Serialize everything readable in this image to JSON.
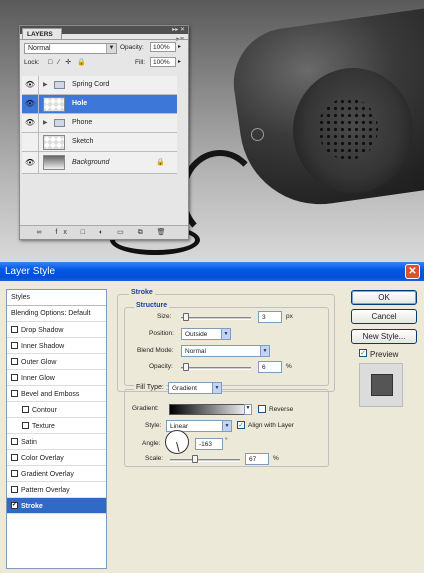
{
  "layers_panel": {
    "tab": "LAYERS",
    "menu_glyph": "▸≡",
    "collapse_glyph": "▸▸ ✕",
    "blend_mode": "Normal",
    "opacity_label": "Opacity:",
    "opacity_value": "100%",
    "lock_label": "Lock:",
    "lock_icons": "□ ∕ ✛ 🔒",
    "fill_label": "Fill:",
    "fill_value": "100%",
    "eye_glyph": "👁",
    "expand_glyph": "▶",
    "lock_glyph": "🔒",
    "layers": [
      {
        "name": "Spring Cord"
      },
      {
        "name": "Hole"
      },
      {
        "name": "Phone"
      },
      {
        "name": "Sketch"
      },
      {
        "name": "Background"
      }
    ],
    "footer_icons": "∞ fx □ ◐ ▭ ⧉ 🗑"
  },
  "dialog": {
    "title": "Layer Style",
    "close": "✕",
    "styles_header": "Styles",
    "blending_options": "Blending Options: Default",
    "style_items": [
      "Drop Shadow",
      "Inner Shadow",
      "Outer Glow",
      "Inner Glow",
      "Bevel and Emboss",
      "Contour",
      "Texture",
      "Satin",
      "Color Overlay",
      "Gradient Overlay",
      "Pattern Overlay",
      "Stroke"
    ],
    "stroke_group": "Stroke",
    "structure_group": "Structure",
    "size_label": "Size:",
    "size_value": "3",
    "size_unit": "px",
    "position_label": "Position:",
    "position_value": "Outside",
    "blend_label": "Blend Mode:",
    "blend_value": "Normal",
    "opacity_label": "Opacity:",
    "opacity_value": "6",
    "opacity_unit": "%",
    "fill_group_label": "Fill Type:",
    "fill_type": "Gradient",
    "gradient_label": "Gradient:",
    "reverse_label": "Reverse",
    "style_label": "Style:",
    "style_value": "Linear",
    "align_label": "Align with Layer",
    "angle_label": "Angle:",
    "angle_value": "-163",
    "angle_unit": "°",
    "scale_label": "Scale:",
    "scale_value": "67",
    "scale_unit": "%",
    "ok": "OK",
    "cancel": "Cancel",
    "new_style": "New Style...",
    "preview_label": "Preview",
    "check_glyph": "✓",
    "dropdown_glyph": "▼"
  }
}
